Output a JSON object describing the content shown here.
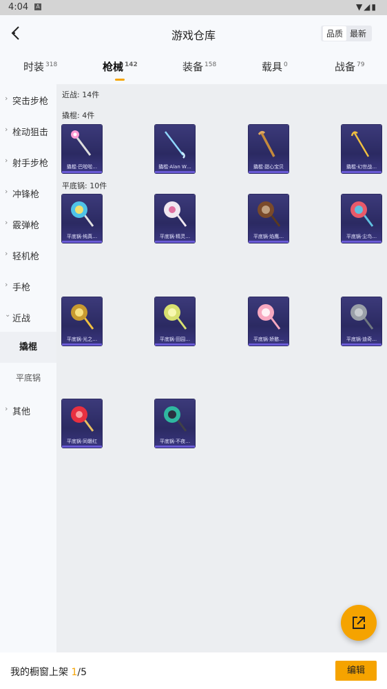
{
  "statusbar": {
    "time": "4:04",
    "app_icon": "A",
    "right_icons": "▼◢▮"
  },
  "header": {
    "title": "游戏仓库",
    "sort_quality": "品质",
    "sort_latest": "最新"
  },
  "tabs": [
    {
      "label": "时装",
      "count": "318"
    },
    {
      "label": "枪械",
      "count": "142"
    },
    {
      "label": "装备",
      "count": "158"
    },
    {
      "label": "载具",
      "count": "0"
    },
    {
      "label": "战备",
      "count": "79"
    }
  ],
  "sidebar": {
    "items": [
      {
        "label": "突击步枪"
      },
      {
        "label": "栓动狙击"
      },
      {
        "label": "射手步枪"
      },
      {
        "label": "冲锋枪"
      },
      {
        "label": "霰弹枪"
      },
      {
        "label": "轻机枪"
      },
      {
        "label": "手枪"
      },
      {
        "label": "近战"
      }
    ],
    "sub_items": [
      {
        "label": "撬棍"
      },
      {
        "label": "平底锅"
      }
    ],
    "other": {
      "label": "其他"
    }
  },
  "content": {
    "melee_header": "近战: 14件",
    "crowbar_header": "撬棍: 4件",
    "pan_header": "平底锅: 10件",
    "crowbars": [
      {
        "name": "撬棍·巴啦啦…",
        "color": "#ff9ad5"
      },
      {
        "name": "撬棍·Alan W…",
        "color": "#8fd8ff"
      },
      {
        "name": "撬棍·甜心宝贝",
        "color": "#c48a3c"
      },
      {
        "name": "撬棍·幻世战…",
        "color": "#f0c040"
      }
    ],
    "pans": [
      {
        "name": "平底锅·纯真…",
        "color": "#4fc3e8"
      },
      {
        "name": "平底锅·精灵…",
        "color": "#f0e8f0"
      },
      {
        "name": "平底锅·焰鹰…",
        "color": "#7a4a2a"
      },
      {
        "name": "平底锅·尘鸟…",
        "color": "#e85a6a"
      },
      {
        "name": "平底锅·光之…",
        "color": "#f0c040"
      },
      {
        "name": "平底锅·田园…",
        "color": "#d8e070"
      },
      {
        "name": "平底锅·娇憨…",
        "color": "#f8a8c0"
      },
      {
        "name": "平底锅·迪奇…",
        "color": "#9aa0a8"
      },
      {
        "name": "平底锅·同磐红",
        "color": "#e83040"
      },
      {
        "name": "平底锅·不夜…",
        "color": "#2fb8a0"
      }
    ]
  },
  "bottom": {
    "label": "我的橱窗上架 ",
    "current": "1",
    "total": "/5",
    "edit": "编辑"
  }
}
